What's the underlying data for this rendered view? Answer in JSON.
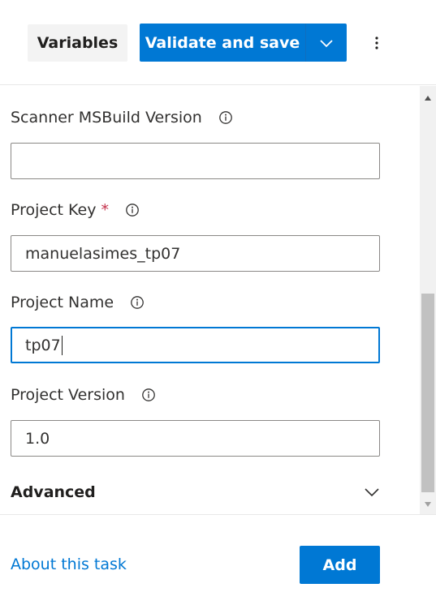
{
  "toolbar": {
    "variables_label": "Variables",
    "validate_label": "Validate and save"
  },
  "fields": [
    {
      "label": "Scanner MSBuild Version",
      "required": false,
      "value": ""
    },
    {
      "label": "Project Key",
      "required": true,
      "required_mark": "*",
      "value": "manuelasimes_tp07"
    },
    {
      "label": "Project Name",
      "required": false,
      "value": "tp07"
    },
    {
      "label": "Project Version",
      "required": false,
      "value": "1.0"
    }
  ],
  "advanced": {
    "label": "Advanced"
  },
  "footer": {
    "about_label": "About this task",
    "add_label": "Add"
  },
  "colors": {
    "accent": "#0078d4",
    "required": "#c4314b",
    "secondary_button": "#f3f3f3"
  },
  "icons": {
    "info": "info-icon",
    "split": "chevron-down-icon",
    "more": "more-vertical-icon",
    "advanced": "chevron-down-icon"
  }
}
